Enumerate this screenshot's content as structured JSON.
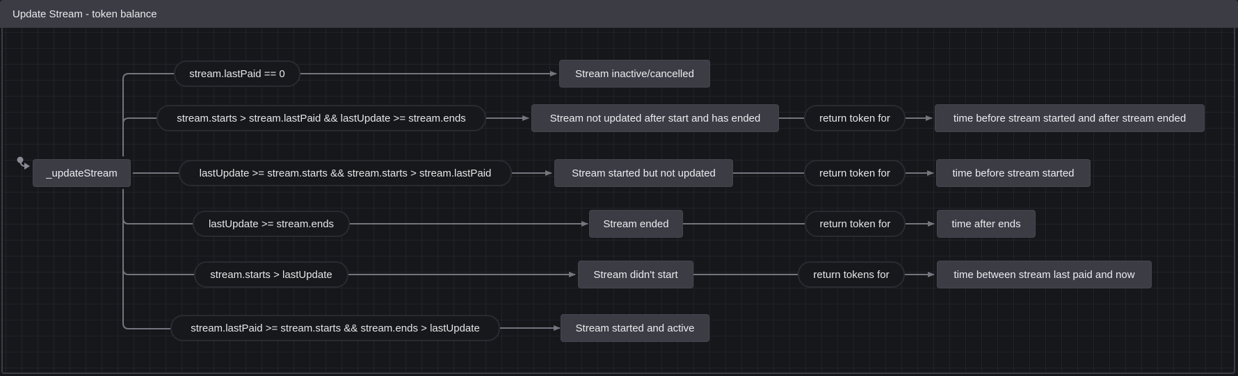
{
  "window": {
    "title": "Update Stream - token balance"
  },
  "diagram": {
    "root_state": "_updateStream",
    "branches": [
      {
        "guard": "stream.lastPaid == 0",
        "target": "Stream inactive/cancelled"
      },
      {
        "guard": "stream.starts > stream.lastPaid && lastUpdate >= stream.ends",
        "target": "Stream not updated after start and has ended",
        "action": "return token for",
        "result": "time before stream started and after stream ended"
      },
      {
        "guard": "lastUpdate >= stream.starts && stream.starts > stream.lastPaid",
        "target": "Stream started but not updated",
        "action": "return token for",
        "result": "time before stream started"
      },
      {
        "guard": "lastUpdate >= stream.ends",
        "target": "Stream ended",
        "action": "return token for",
        "result": "time after ends"
      },
      {
        "guard": "stream.starts > lastUpdate",
        "target": "Stream didn't start",
        "action": "return tokens for",
        "result": "time between stream last paid and now"
      },
      {
        "guard": "stream.lastPaid >= stream.starts && stream.ends > lastUpdate",
        "target": "Stream started and active"
      }
    ]
  },
  "colors": {
    "background": "#16171a",
    "titlebar": "#3b3c44",
    "state_fill": "#3b3c44",
    "guard_fill": "#17181b",
    "edge": "#74757e"
  }
}
